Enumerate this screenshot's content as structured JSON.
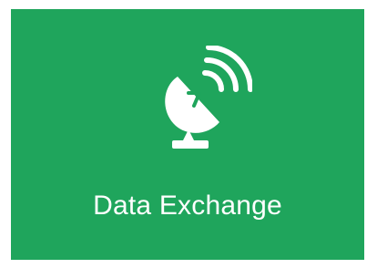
{
  "tile": {
    "label": "Data Exchange",
    "icon": "satellite-dish-icon",
    "background_color": "#1fa55c",
    "foreground_color": "#ffffff"
  }
}
